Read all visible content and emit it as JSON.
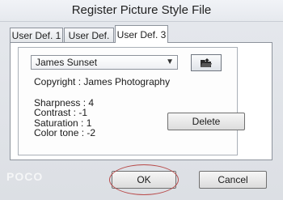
{
  "window": {
    "title": "Register Picture Style File"
  },
  "tabs": [
    {
      "label": "User Def. 1"
    },
    {
      "label": "User Def. 2"
    },
    {
      "label": "User Def. 3",
      "active": true
    }
  ],
  "style_select": {
    "value": "James Sunset"
  },
  "info": {
    "copyright": "Copyright : James Photography",
    "sharpness": "Sharpness : 4",
    "contrast": "Contrast : -1",
    "saturation": "Saturation : 1",
    "color_tone": "Color tone : -2"
  },
  "buttons": {
    "delete": "Delete",
    "ok": "OK",
    "cancel": "Cancel"
  },
  "icons": {
    "open_folder": "open-folder-icon",
    "dropdown": "chevron-down-icon"
  },
  "colors": {
    "highlight_oval": "#b84a4a"
  }
}
